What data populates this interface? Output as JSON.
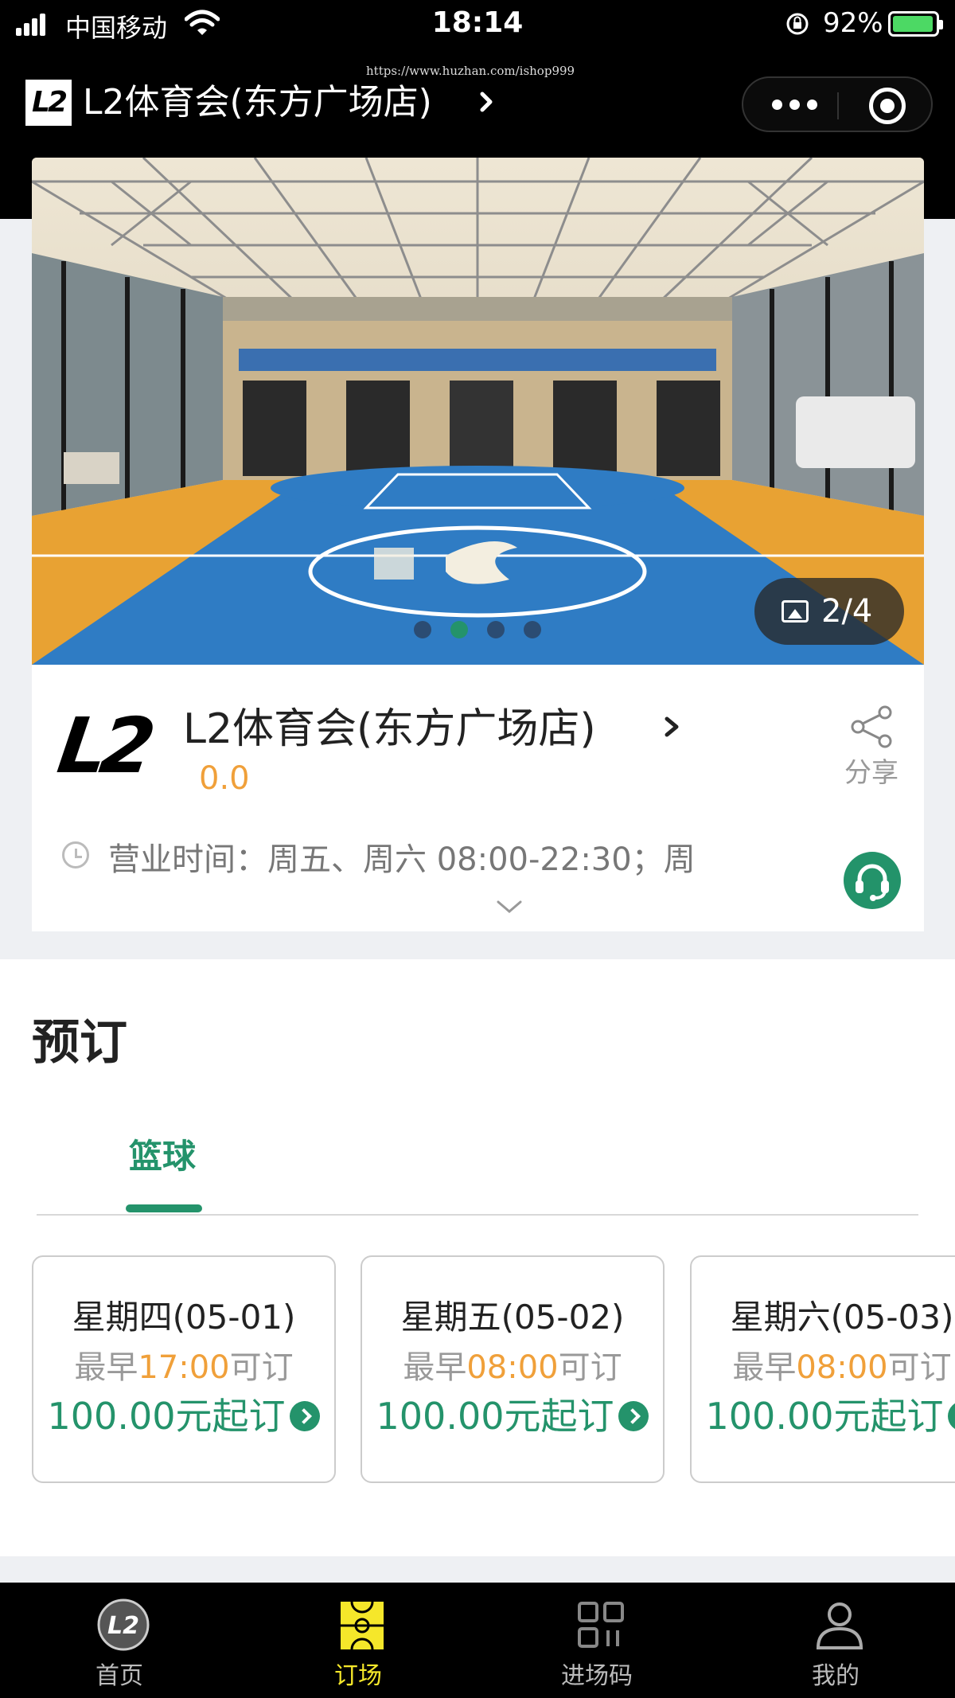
{
  "status_bar": {
    "carrier": "中国移动",
    "time": "18:14",
    "battery_percent": "92%"
  },
  "watermark": "https://www.huzhan.com/ishop999",
  "nav": {
    "logo_text": "L2",
    "title": "L2体育会(东方广场店)"
  },
  "banner": {
    "counter": "2/4",
    "dots_total": 4,
    "dots_active_index": 1
  },
  "venue": {
    "logo_text": "L2",
    "name": "L2体育会(东方广场店)",
    "rating": "0.0",
    "share_label": "分享",
    "hours": "营业时间：周五、周六 08:00-22:30；周"
  },
  "booking": {
    "title": "预订",
    "tabs": [
      {
        "label": "篮球",
        "active": true
      }
    ],
    "days": [
      {
        "day": "星期四(05-01)",
        "earliest_prefix": "最早",
        "earliest_time": "17:00",
        "earliest_suffix": "可订",
        "price": "100.00元起订"
      },
      {
        "day": "星期五(05-02)",
        "earliest_prefix": "最早",
        "earliest_time": "08:00",
        "earliest_suffix": "可订",
        "price": "100.00元起订"
      },
      {
        "day": "星期六(05-03)",
        "earliest_prefix": "最早",
        "earliest_time": "08:00",
        "earliest_suffix": "可订",
        "price": "100.00元起订"
      }
    ]
  },
  "tab_bar": {
    "items": [
      {
        "label": "首页",
        "icon": "l2-logo-icon",
        "active": false
      },
      {
        "label": "订场",
        "icon": "court-icon",
        "active": true
      },
      {
        "label": "进场码",
        "icon": "qr-grid-icon",
        "active": false
      },
      {
        "label": "我的",
        "icon": "user-icon",
        "active": false
      }
    ]
  },
  "colors": {
    "accent_green": "#24936b",
    "accent_orange": "#f0a03a",
    "tab_active_yellow": "#f5e72a"
  }
}
